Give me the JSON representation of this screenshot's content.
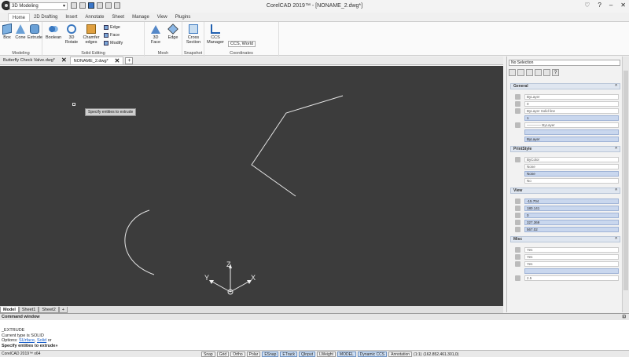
{
  "titlebar": {
    "workspace": "3D Modeling",
    "window_title": "CorelCAD 2019™ - [NONAME_2.dwg*]",
    "controls": [
      "♡",
      "?",
      "–",
      "✕"
    ]
  },
  "ribbon_tabs": [
    "Home",
    "2D Drafting",
    "Insert",
    "Annotate",
    "Sheet",
    "Manage",
    "View",
    "Plugins"
  ],
  "ribbon": {
    "modeling": {
      "label": "Modeling",
      "buttons": [
        "Box",
        "Cone",
        "Extrude"
      ]
    },
    "solid_editing": {
      "label": "Solid Editing",
      "buttons": [
        "Boolean",
        "3D Rotate",
        "Chamfer edges"
      ],
      "small": [
        "Edge",
        "Face",
        "Modify"
      ]
    },
    "mesh": {
      "label": "Mesh",
      "buttons": [
        "3D Face",
        "Edge"
      ]
    },
    "snapshot": {
      "label": "Snapshot",
      "buttons": [
        "Cross Section"
      ]
    },
    "coordinates": {
      "label": "Coordinates",
      "buttons": [
        "CCS Manager"
      ],
      "ccs_value": "CCS, World"
    }
  },
  "doc_tabs": [
    {
      "label": "Butterfly Check Valve.dwg*",
      "active": false
    },
    {
      "label": "NONAME_2.dwg*",
      "active": true
    }
  ],
  "canvas": {
    "tooltip": "Specify entities to extrude",
    "axes": {
      "x": "X",
      "y": "Y",
      "z": "Z"
    },
    "background": "#3c3c3c"
  },
  "sheet_tabs": [
    "Model",
    "Sheet1",
    "Sheet2",
    "+"
  ],
  "command_window": {
    "title": "Command window",
    "lines": {
      "cmd": "_EXTRUDE",
      "type": "Current type is SOLID",
      "options_prefix": "Options: ",
      "opt1": "SUrface",
      "opt_sep": ", ",
      "opt2": "Solid",
      "opt_suffix": " or",
      "prompt": "Specify entities to extrude»"
    }
  },
  "status_bar": {
    "version": "CorelCAD 2019™ x64",
    "toggles": [
      {
        "label": "Snap",
        "on": false
      },
      {
        "label": "Grid",
        "on": false
      },
      {
        "label": "Ortho",
        "on": false
      },
      {
        "label": "Polar",
        "on": false
      },
      {
        "label": "ESnap",
        "on": true
      },
      {
        "label": "ETrack",
        "on": true
      },
      {
        "label": "QInput",
        "on": true
      },
      {
        "label": "LWeight",
        "on": false
      },
      {
        "label": "MODEL",
        "on": true
      },
      {
        "label": "Dynamic CCS",
        "on": true
      },
      {
        "label": "Annotation",
        "on": false
      }
    ],
    "scale": "(1:1)",
    "coords": "(162.852,461.301,0)"
  },
  "properties": {
    "selection": "No Selection",
    "sections": {
      "general": "General",
      "printstyle": "PrintStyle",
      "view": "View",
      "misc": "Misc"
    },
    "general_rows": [
      "ByLayer",
      "0",
      "ByLayer     Solid line",
      "1",
      "———— ByLayer",
      "",
      "ByLayer"
    ],
    "printstyle_rows": [
      "ByColor",
      "None",
      "None",
      "No"
    ],
    "view_rows": [
      "-15.704",
      "180.141",
      "0",
      "327.369",
      "567.02"
    ],
    "misc_rows": [
      "Yes",
      "Yes",
      "Yes",
      "",
      "2.5"
    ]
  }
}
